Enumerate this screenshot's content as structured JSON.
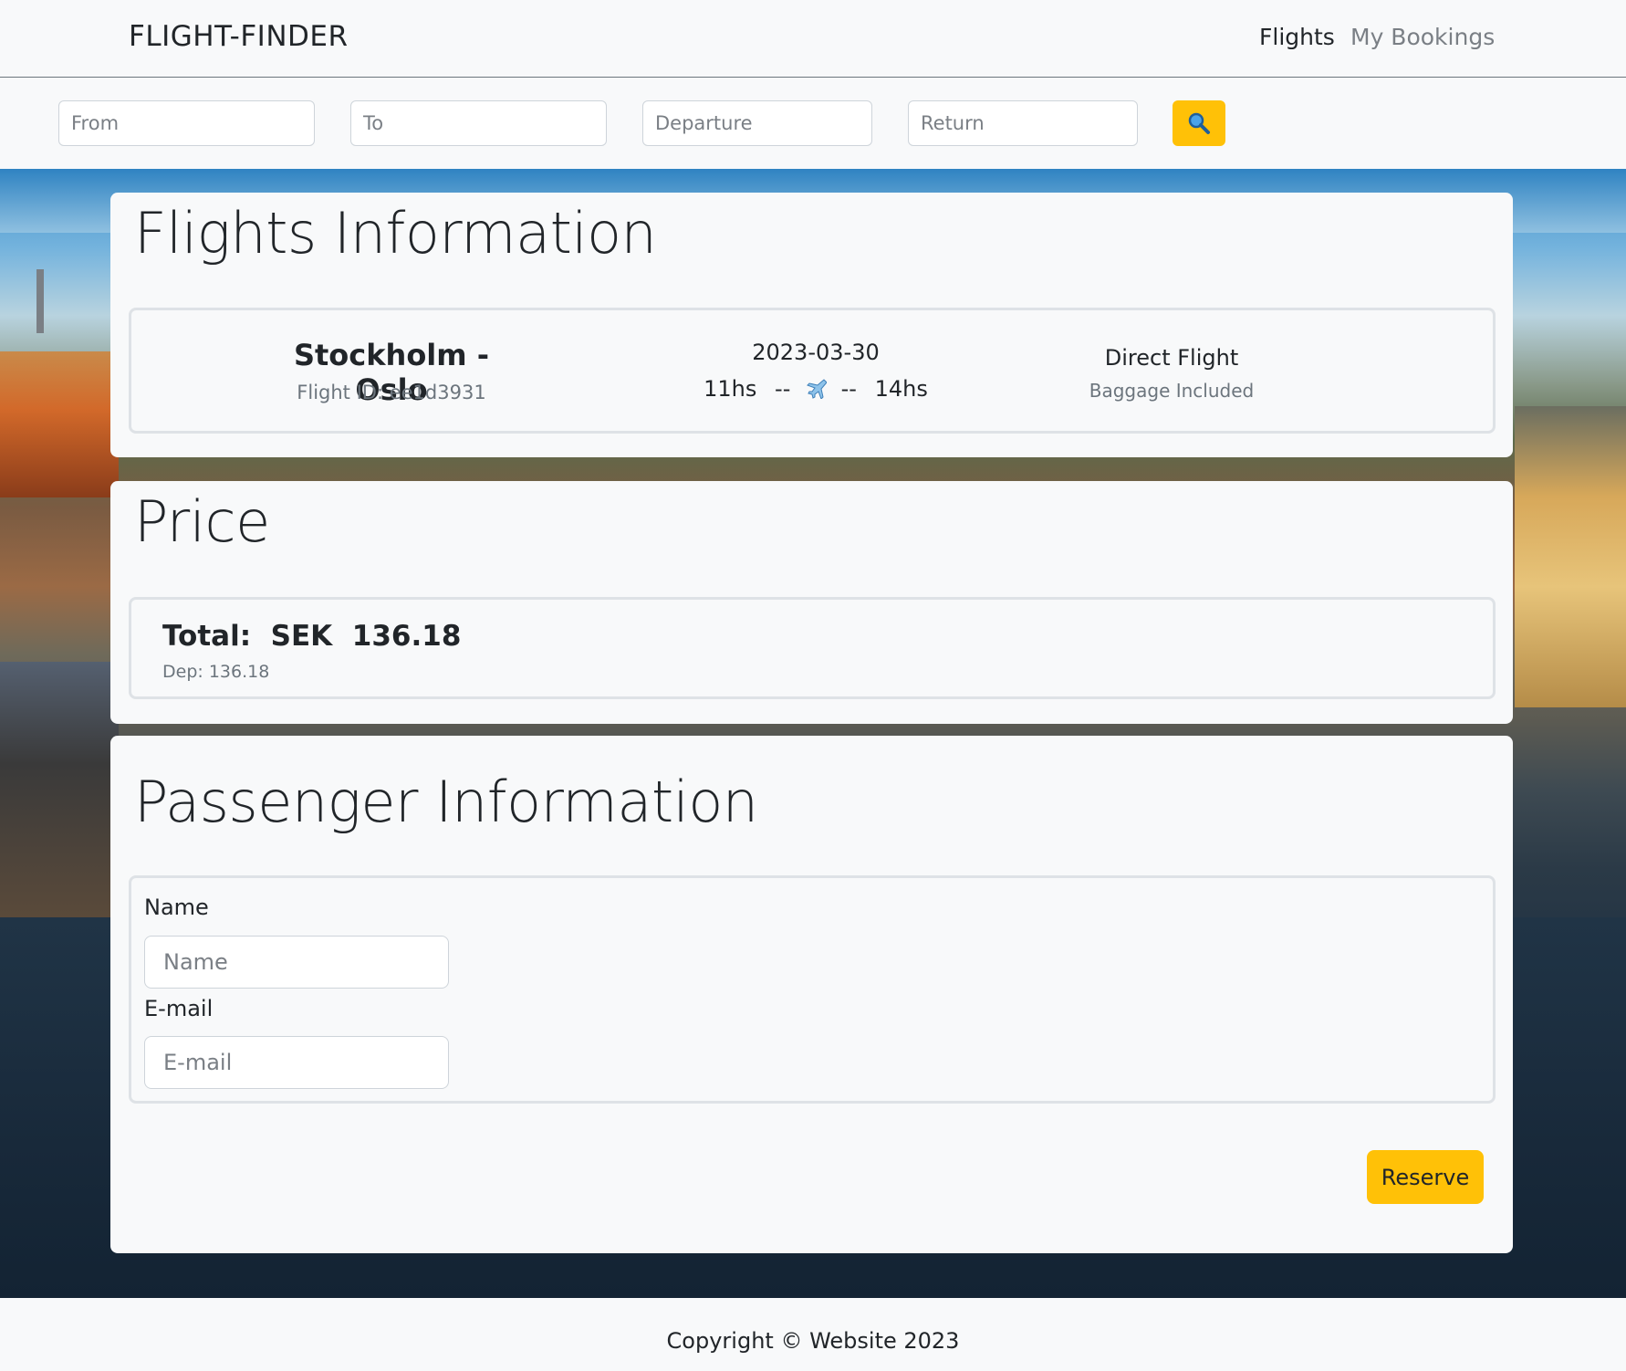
{
  "navbar": {
    "brand": "FLIGHT-FINDER",
    "links": [
      "Flights",
      "My Bookings"
    ]
  },
  "search": {
    "from_placeholder": "From",
    "to_placeholder": "To",
    "departure_placeholder": "Departure",
    "return_placeholder": "Return",
    "button_icon": "magnifier-icon"
  },
  "flights_section": {
    "title": "Flights Information",
    "flight": {
      "route": "Stockholm - Oslo",
      "flight_id": "Flight ID: ee1d3931",
      "date": "2023-03-30",
      "depart_time": "11hs",
      "dash_left": "--",
      "dash_right": "--",
      "arrive_time": "14hs",
      "plane_icon": "airplane-icon",
      "type": "Direct Flight",
      "baggage": "Baggage Included"
    }
  },
  "price_section": {
    "title": "Price",
    "total": "Total:  SEK  136.18",
    "dep": "Dep: 136.18"
  },
  "passenger_section": {
    "title": "Passenger Information",
    "name_label": "Name",
    "name_placeholder": "Name",
    "email_label": "E-mail",
    "email_placeholder": "E-mail",
    "reserve_label": "Reserve"
  },
  "footer": {
    "text": "Copyright © Website 2023"
  },
  "colors": {
    "accent": "#ffc107",
    "background": "#f8f9fa"
  }
}
